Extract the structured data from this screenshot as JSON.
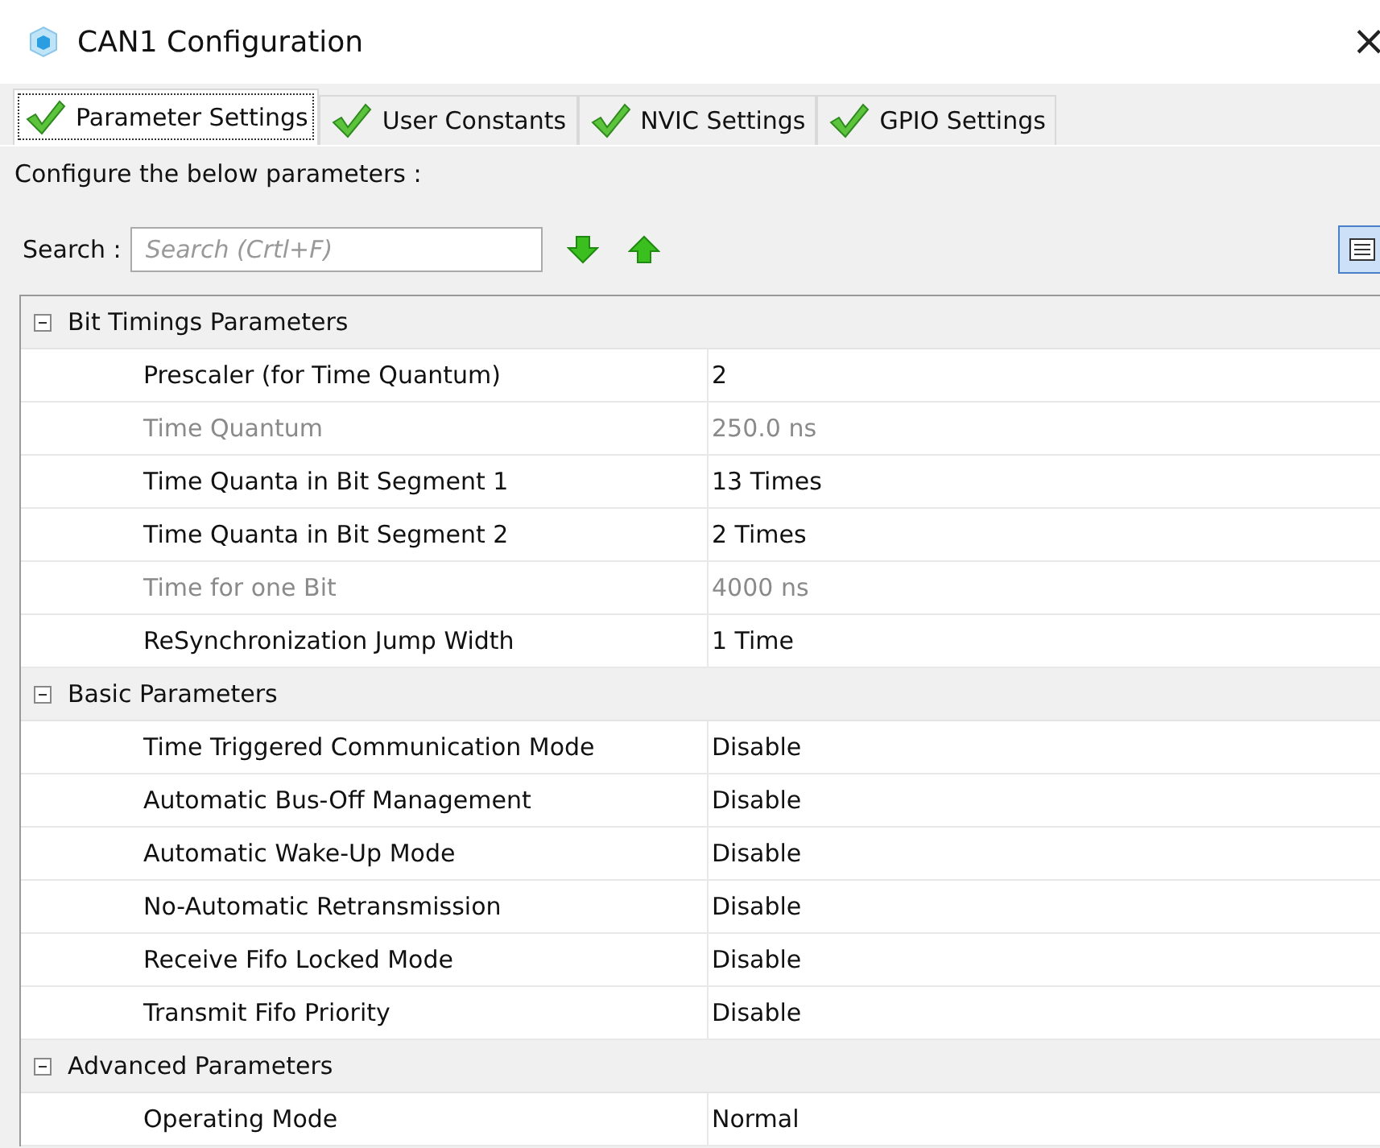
{
  "window": {
    "title": "CAN1 Configuration",
    "close": "×"
  },
  "tabs": [
    {
      "label": "Parameter Settings",
      "selected": true
    },
    {
      "label": "User Constants",
      "selected": false
    },
    {
      "label": "NVIC Settings",
      "selected": false
    },
    {
      "label": "GPIO Settings",
      "selected": false
    }
  ],
  "instruction": "Configure the below parameters :",
  "search": {
    "label": "Search :",
    "placeholder": "Search (Crtl+F)"
  },
  "groups": [
    {
      "title": "Bit Timings Parameters",
      "expanded": true,
      "rows": [
        {
          "name": "Prescaler (for Time Quantum)",
          "value": "2",
          "disabled": false
        },
        {
          "name": "Time Quantum",
          "value": "250.0 ns",
          "disabled": true
        },
        {
          "name": "Time Quanta in Bit Segment 1",
          "value": "13 Times",
          "disabled": false
        },
        {
          "name": "Time Quanta in Bit Segment 2",
          "value": "2 Times",
          "disabled": false
        },
        {
          "name": "Time for one Bit",
          "value": "4000 ns",
          "disabled": true
        },
        {
          "name": "ReSynchronization Jump Width",
          "value": "1 Time",
          "disabled": false
        }
      ]
    },
    {
      "title": "Basic Parameters",
      "expanded": true,
      "rows": [
        {
          "name": "Time Triggered Communication Mode",
          "value": "Disable",
          "disabled": false
        },
        {
          "name": "Automatic Bus-Off Management",
          "value": "Disable",
          "disabled": false
        },
        {
          "name": "Automatic Wake-Up Mode",
          "value": "Disable",
          "disabled": false
        },
        {
          "name": "No-Automatic Retransmission",
          "value": "Disable",
          "disabled": false
        },
        {
          "name": "Receive Fifo Locked Mode",
          "value": "Disable",
          "disabled": false
        },
        {
          "name": "Transmit Fifo Priority",
          "value": "Disable",
          "disabled": false
        }
      ]
    },
    {
      "title": "Advanced Parameters",
      "expanded": true,
      "rows": [
        {
          "name": "Operating Mode",
          "value": "Normal",
          "disabled": false
        }
      ]
    }
  ]
}
